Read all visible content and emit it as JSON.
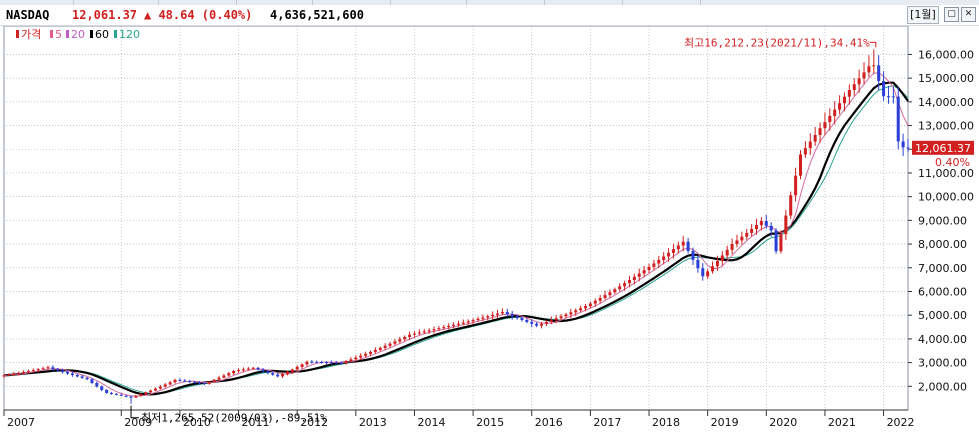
{
  "header": {
    "symbol": "NASDAQ",
    "price": "12,061.37",
    "change": "▲ 48.64 (0.40%)",
    "volume": "4,636,521,600",
    "period": "[1월]",
    "btn_restore": "▢",
    "btn_close": "✕"
  },
  "legend": {
    "items": [
      {
        "label": "가격",
        "color": "#d21f1f"
      },
      {
        "label": "5",
        "color": "#e25b8a"
      },
      {
        "label": "20",
        "color": "#c05bc8"
      },
      {
        "label": "60",
        "color": "#000000"
      },
      {
        "label": "120",
        "color": "#2aa390"
      }
    ]
  },
  "colors": {
    "up": "#d21f1f",
    "down": "#2b3fd6",
    "ma20": "#d36aa0",
    "ma60": "#000000",
    "ma120": "#2aa390",
    "grid": "#9aa4b0",
    "tag_bg": "#d21f1f"
  },
  "chart_data": {
    "type": "candlestick",
    "x_axis": {
      "labels": [
        "2007",
        "2009",
        "2010",
        "2011",
        "2012",
        "2013",
        "2014",
        "2015",
        "2016",
        "2017",
        "2018",
        "2019",
        "2020",
        "2021",
        "2022"
      ],
      "range": [
        "2007-01",
        "2022-06"
      ]
    },
    "y_axis": {
      "range": [
        1000,
        17200
      ],
      "ticks": [
        2000,
        3000,
        4000,
        5000,
        6000,
        7000,
        8000,
        9000,
        10000,
        11000,
        12000,
        13000,
        14000,
        15000,
        16000
      ],
      "tick_labels": [
        "2,000.00",
        "3,000.00",
        "4,000.00",
        "5,000.00",
        "6,000.00",
        "7,000.00",
        "8,000.00",
        "9,000.00",
        "10,000.00",
        "11,000.00",
        "12,000.00",
        "13,000.00",
        "14,000.00",
        "15,000.00",
        "16,000.00"
      ],
      "side": "right"
    },
    "grid": true,
    "anchors": [
      [
        "2007-01",
        2460
      ],
      [
        "2007-10",
        2800
      ],
      [
        "2008-06",
        2300
      ],
      [
        "2008-10",
        1720
      ],
      [
        "2009-03",
        1530
      ],
      [
        "2009-12",
        2270
      ],
      [
        "2010-06",
        2110
      ],
      [
        "2010-12",
        2650
      ],
      [
        "2011-04",
        2780
      ],
      [
        "2011-09",
        2420
      ],
      [
        "2012-03",
        3040
      ],
      [
        "2012-10",
        2990
      ],
      [
        "2013-12",
        4180
      ],
      [
        "2014-12",
        4740
      ],
      [
        "2015-07",
        5130
      ],
      [
        "2016-02",
        4560
      ],
      [
        "2016-12",
        5380
      ],
      [
        "2017-12",
        6900
      ],
      [
        "2018-08",
        8100
      ],
      [
        "2018-12",
        6640
      ],
      [
        "2019-06",
        8000
      ],
      [
        "2019-12",
        8970
      ],
      [
        "2020-02",
        8570
      ],
      [
        "2020-03",
        7700
      ],
      [
        "2020-06",
        10060
      ],
      [
        "2020-08",
        11780
      ],
      [
        "2020-12",
        12890
      ],
      [
        "2021-06",
        14500
      ],
      [
        "2021-10",
        15500
      ],
      [
        "2021-11",
        15540
      ],
      [
        "2022-01",
        14240
      ],
      [
        "2022-03",
        14220
      ],
      [
        "2022-04",
        12330
      ],
      [
        "2022-05",
        12080
      ]
    ],
    "high_marker": {
      "date": "2021-11",
      "value": 16212.23,
      "label": "최고16,212.23(2021/11),34.41%"
    },
    "low_marker": {
      "date": "2009-03",
      "value": 1265.52,
      "label": "최저1,265.52(2009/03),-89.51%"
    },
    "last": {
      "value": 12061.37,
      "label": "12,061.37",
      "change_label": "0.40%"
    },
    "moving_averages": [
      5,
      20,
      60,
      120
    ]
  }
}
